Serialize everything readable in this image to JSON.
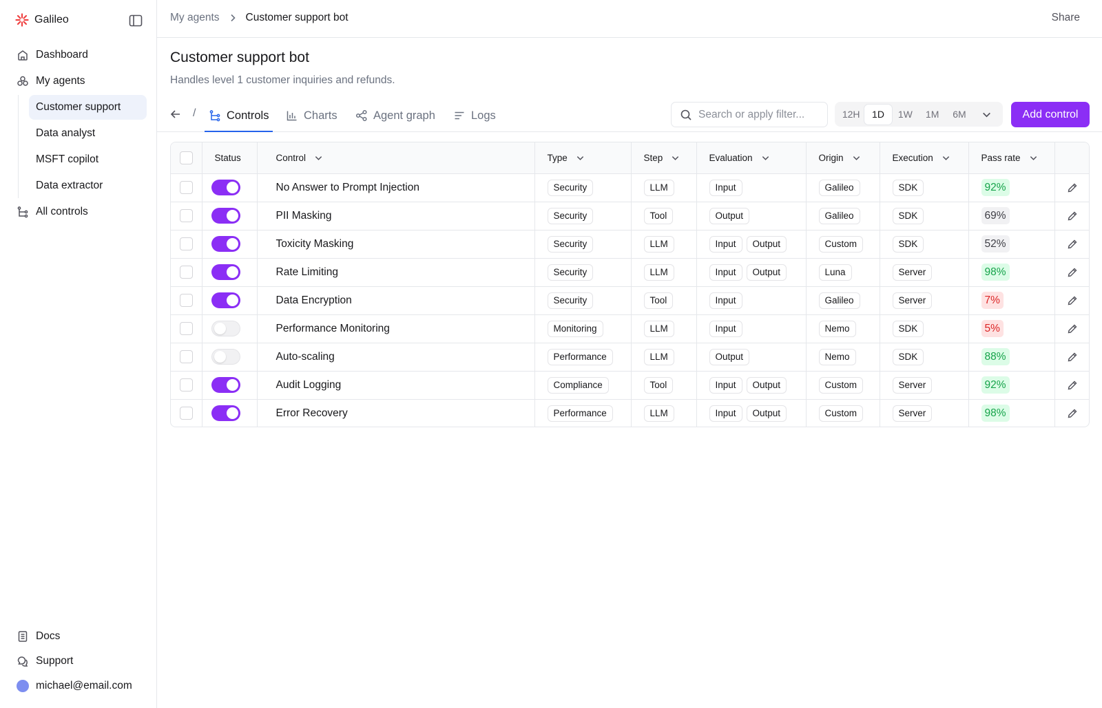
{
  "app": {
    "name": "Galileo"
  },
  "sidebar": {
    "nav": [
      {
        "label": "Dashboard",
        "icon": "home-icon"
      },
      {
        "label": "My agents",
        "icon": "agents-icon"
      }
    ],
    "agents": [
      "Customer support",
      "Data analyst",
      "MSFT copilot",
      "Data extractor"
    ],
    "all_controls": "All controls",
    "footer": {
      "docs": "Docs",
      "support": "Support",
      "user": "michael@email.com"
    }
  },
  "header": {
    "breadcrumb": [
      "My agents",
      "Customer support bot"
    ],
    "share": "Share"
  },
  "page": {
    "title": "Customer support bot",
    "subtitle": "Handles level 1 customer inquiries and refunds."
  },
  "tabs": {
    "slash": "/",
    "items": [
      {
        "label": "Controls",
        "active": true
      },
      {
        "label": "Charts",
        "active": false
      },
      {
        "label": "Agent graph",
        "active": false
      },
      {
        "label": "Logs",
        "active": false
      }
    ],
    "search_placeholder": "Search or apply filter...",
    "ranges": [
      "12H",
      "1D",
      "1W",
      "1M",
      "6M"
    ],
    "active_range": "1D",
    "add_button": "Add control"
  },
  "table": {
    "headers": [
      "Status",
      "Control",
      "Type",
      "Step",
      "Evaluation",
      "Origin",
      "Execution",
      "Pass rate"
    ],
    "rows": [
      {
        "enabled": true,
        "control": "No Answer to Prompt Injection",
        "type": "Security",
        "step": "LLM",
        "evaluation": [
          "Input"
        ],
        "origin": "Galileo",
        "execution": "SDK",
        "pass_rate": "92%",
        "rate_level": "good"
      },
      {
        "enabled": true,
        "control": "PII Masking",
        "type": "Security",
        "step": "Tool",
        "evaluation": [
          "Output"
        ],
        "origin": "Galileo",
        "execution": "SDK",
        "pass_rate": "69%",
        "rate_level": "mid"
      },
      {
        "enabled": true,
        "control": "Toxicity Masking",
        "type": "Security",
        "step": "LLM",
        "evaluation": [
          "Input",
          "Output"
        ],
        "origin": "Custom",
        "execution": "SDK",
        "pass_rate": "52%",
        "rate_level": "mid"
      },
      {
        "enabled": true,
        "control": "Rate Limiting",
        "type": "Security",
        "step": "LLM",
        "evaluation": [
          "Input",
          "Output"
        ],
        "origin": "Luna",
        "execution": "Server",
        "pass_rate": "98%",
        "rate_level": "good"
      },
      {
        "enabled": true,
        "control": "Data Encryption",
        "type": "Security",
        "step": "Tool",
        "evaluation": [
          "Input"
        ],
        "origin": "Galileo",
        "execution": "Server",
        "pass_rate": "7%",
        "rate_level": "bad"
      },
      {
        "enabled": false,
        "control": "Performance Monitoring",
        "type": "Monitoring",
        "step": "LLM",
        "evaluation": [
          "Input"
        ],
        "origin": "Nemo",
        "execution": "SDK",
        "pass_rate": "5%",
        "rate_level": "bad"
      },
      {
        "enabled": false,
        "control": "Auto-scaling",
        "type": "Performance",
        "step": "LLM",
        "evaluation": [
          "Output"
        ],
        "origin": "Nemo",
        "execution": "SDK",
        "pass_rate": "88%",
        "rate_level": "good"
      },
      {
        "enabled": true,
        "control": "Audit Logging",
        "type": "Compliance",
        "step": "Tool",
        "evaluation": [
          "Input",
          "Output"
        ],
        "origin": "Custom",
        "execution": "Server",
        "pass_rate": "92%",
        "rate_level": "good"
      },
      {
        "enabled": true,
        "control": "Error Recovery",
        "type": "Performance",
        "step": "LLM",
        "evaluation": [
          "Input",
          "Output"
        ],
        "origin": "Custom",
        "execution": "Server",
        "pass_rate": "98%",
        "rate_level": "good"
      }
    ]
  },
  "colors": {
    "accent": "#8b2ef5",
    "tab_underline": "#2563eb",
    "pass_good": "#16a34a",
    "pass_bad": "#dc2626",
    "brand_logo": "#ef4444",
    "avatar": "#7d8ef0"
  }
}
